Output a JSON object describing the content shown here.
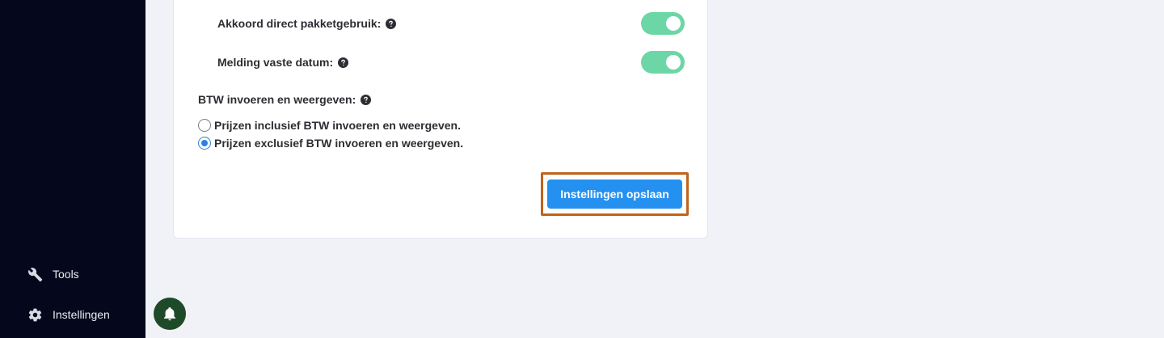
{
  "sidebar": {
    "items": [
      {
        "label": "Tools",
        "icon": "wrench-icon"
      },
      {
        "label": "Instellingen",
        "icon": "gear-icon"
      }
    ]
  },
  "settings": {
    "toggles": [
      {
        "label": "Akkoord direct pakketgebruik:",
        "enabled": true
      },
      {
        "label": "Melding vaste datum:",
        "enabled": true
      }
    ],
    "vat_section": {
      "label": "BTW invoeren en weergeven:",
      "options": [
        {
          "label": "Prijzen inclusief BTW invoeren en weergeven.",
          "selected": false
        },
        {
          "label": "Prijzen exclusief BTW invoeren en weergeven.",
          "selected": true
        }
      ]
    },
    "save_label": "Instellingen opslaan"
  },
  "colors": {
    "sidebar_bg": "#05081c",
    "toggle_on": "#6dd6a7",
    "primary_button": "#2490f0",
    "highlight_border": "#c0631c",
    "bell_bg": "#1f4a2a"
  }
}
